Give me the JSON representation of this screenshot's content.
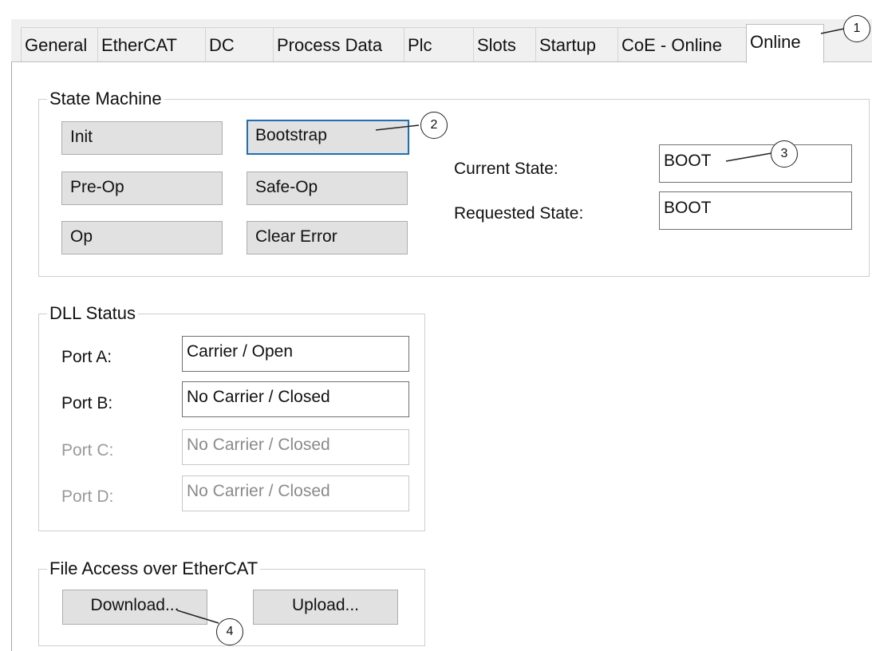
{
  "tabs": [
    {
      "label": "General"
    },
    {
      "label": "EtherCAT"
    },
    {
      "label": "DC"
    },
    {
      "label": "Process Data"
    },
    {
      "label": "Plc"
    },
    {
      "label": "Slots"
    },
    {
      "label": "Startup"
    },
    {
      "label": "CoE - Online"
    },
    {
      "label": "Online"
    }
  ],
  "active_tab": "Online",
  "state_machine": {
    "title": "State Machine",
    "buttons": {
      "init": "Init",
      "bootstrap": "Bootstrap",
      "preop": "Pre-Op",
      "safeop": "Safe-Op",
      "op": "Op",
      "clear_error": "Clear Error"
    },
    "current_state_label": "Current State:",
    "current_state_value": "BOOT",
    "requested_state_label": "Requested State:",
    "requested_state_value": "BOOT"
  },
  "dll_status": {
    "title": "DLL Status",
    "ports": [
      {
        "label": "Port A:",
        "value": "Carrier / Open",
        "enabled": true
      },
      {
        "label": "Port B:",
        "value": "No Carrier / Closed",
        "enabled": true
      },
      {
        "label": "Port C:",
        "value": "No Carrier / Closed",
        "enabled": false
      },
      {
        "label": "Port D:",
        "value": "No Carrier / Closed",
        "enabled": false
      }
    ]
  },
  "file_access": {
    "title": "File Access over EtherCAT",
    "download_label": "Download...",
    "upload_label": "Upload..."
  },
  "callouts": [
    "1",
    "2",
    "3",
    "4"
  ],
  "colors": {
    "focus_border": "#1f6fbf",
    "button_bg": "#e1e1e1",
    "tab_bg": "#f0f0f0"
  }
}
